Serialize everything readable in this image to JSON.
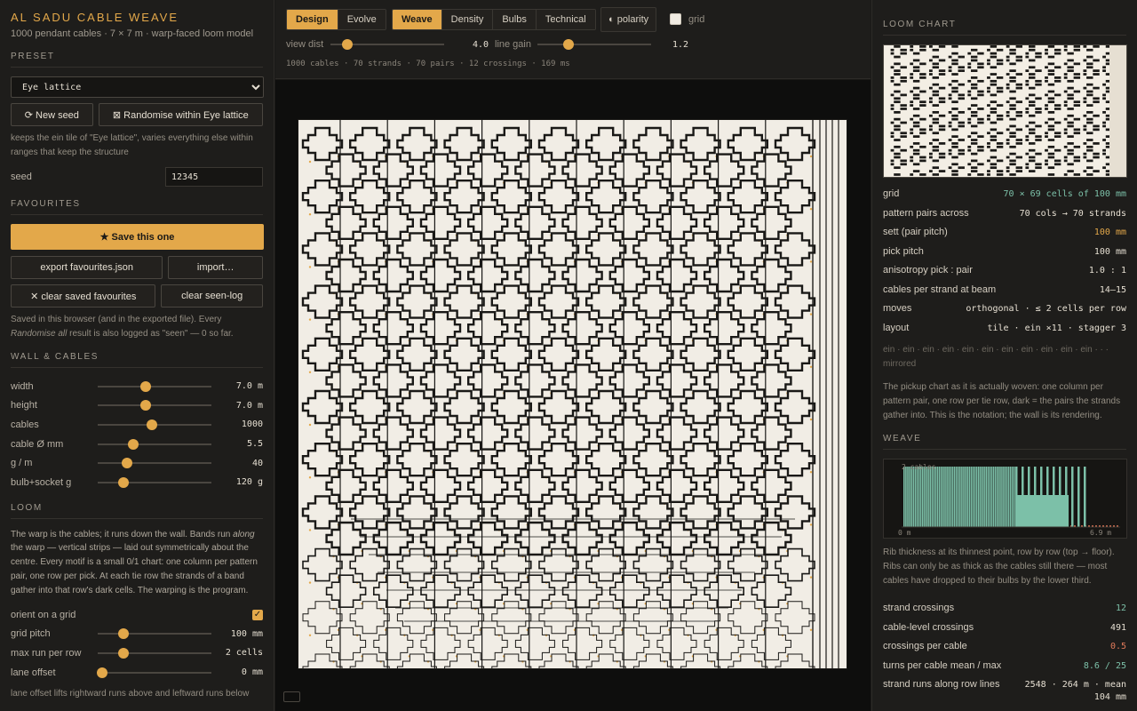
{
  "app": {
    "title": "AL SADU CABLE WEAVE",
    "subtitle": "1000 pendant cables · 7 × 7 m · warp-faced loom model"
  },
  "preset": {
    "heading": "PRESET",
    "selected": "Eye lattice",
    "new_seed_label": "⟳ New seed",
    "randomise_label": "⊠ Randomise within Eye lattice",
    "note": "keeps the ein tile of \"Eye lattice\", varies everything else within ranges that keep the structure",
    "seed_label": "seed",
    "seed_value": "12345"
  },
  "favourites": {
    "heading": "FAVOURITES",
    "save_label": "★ Save this one",
    "export_label": "export favourites.json",
    "import_label": "import…",
    "clear_saved_label": "✕ clear saved favourites",
    "clear_seen_label": "clear seen-log",
    "note_a": "Saved in this browser (and in the exported file). Every ",
    "note_em": "Randomise all",
    "note_b": " result is also logged as \"seen\" — 0 so far."
  },
  "wall": {
    "heading": "WALL & CABLES",
    "sliders": [
      {
        "label": "width",
        "value": "7.0 m",
        "pos": 0.42
      },
      {
        "label": "height",
        "value": "7.0 m",
        "pos": 0.42
      },
      {
        "label": "cables",
        "value": "1000",
        "pos": 0.48
      },
      {
        "label": "cable Ø mm",
        "value": "5.5",
        "pos": 0.31
      },
      {
        "label": "g / m",
        "value": "40",
        "pos": 0.26
      },
      {
        "label": "bulb+socket g",
        "value": "120 g",
        "pos": 0.23
      }
    ]
  },
  "loom": {
    "heading": "LOOM",
    "t1": "The warp is the cables; it runs down the wall. Bands run ",
    "t_em": "along",
    "t2": " the warp — vertical strips — laid out symmetrically about the centre. Every motif is a small 0/1 chart: one column per pattern pair, one row per pick. At each tie row the strands of a band gather into that row's dark cells. The warping is the program.",
    "orient_label": "orient on a grid",
    "sliders": [
      {
        "label": "grid pitch",
        "value": "100 mm",
        "pos": 0.23
      },
      {
        "label": "max run per row",
        "value": "2 cells",
        "pos": 0.23
      },
      {
        "label": "lane offset",
        "value": "0 mm",
        "pos": 0.04
      }
    ],
    "footer_note": "lane offset lifts rightward runs above and leftward runs below"
  },
  "toolbar": {
    "modes": [
      "Design",
      "Evolve"
    ],
    "views": [
      "Weave",
      "Density",
      "Bulbs",
      "Technical"
    ],
    "polarity_label": "◐ polarity",
    "grid_label": "grid",
    "view_dist_label": "view dist",
    "view_dist_value": "4.0",
    "view_dist_pos": 0.15,
    "line_gain_label": "line gain",
    "line_gain_value": "1.2",
    "line_gain_pos": 0.27,
    "stats": "1000 cables · 70 strands · 70 pairs · 12 crossings · 169 ms"
  },
  "loom_chart": {
    "heading": "LOOM CHART",
    "rows": [
      {
        "k": "grid",
        "v": "70 × 69 cells of 100 mm",
        "tone": "green"
      },
      {
        "k": "pattern pairs across",
        "v": "70 cols → 70 strands",
        "tone": ""
      },
      {
        "k": "sett (pair pitch)",
        "v": "100 mm",
        "tone": "orange"
      },
      {
        "k": "pick pitch",
        "v": "100 mm",
        "tone": ""
      },
      {
        "k": "anisotropy pick : pair",
        "v": "1.0 : 1",
        "tone": ""
      },
      {
        "k": "cables per strand at beam",
        "v": "14–15",
        "tone": ""
      },
      {
        "k": "moves",
        "v": "orthogonal · ≤ 2 cells per row",
        "tone": ""
      },
      {
        "k": "layout",
        "v": "tile · ein ×11 · stagger 3",
        "tone": ""
      }
    ],
    "chain": "ein · ein · ein · ein · ein · ein · ein · ein · ein · ein · ein · · · mirrored",
    "note": "The pickup chart as it is actually woven: one column per pattern pair, one row per tie row, dark = the pairs the strands gather into. This is the notation; the wall is its rendering."
  },
  "weave": {
    "heading": "WEAVE",
    "chart_label": "2 cables",
    "x_start": "0 m",
    "x_end": "6.9 m",
    "note": "Rib thickness at its thinnest point, row by row (top → floor). Ribs can only be as thick as the cables still there — most cables have dropped to their bulbs by the lower third.",
    "rows": [
      {
        "k": "strand crossings",
        "v": "12",
        "tone": "green"
      },
      {
        "k": "cable-level crossings",
        "v": "491",
        "tone": ""
      },
      {
        "k": "crossings per cable",
        "v": "0.5",
        "tone": "red"
      },
      {
        "k": "turns per cable mean / max",
        "v": "8.6 / 25",
        "tone": "green"
      },
      {
        "k": "strand runs along row lines",
        "v": "2548 · 264 m · mean 104 mm",
        "tone": ""
      }
    ]
  },
  "colors": {
    "accent": "#e3a84a",
    "green": "#7cc0a8",
    "red": "#e07a5a",
    "wall_bg": "#f1ede5"
  }
}
